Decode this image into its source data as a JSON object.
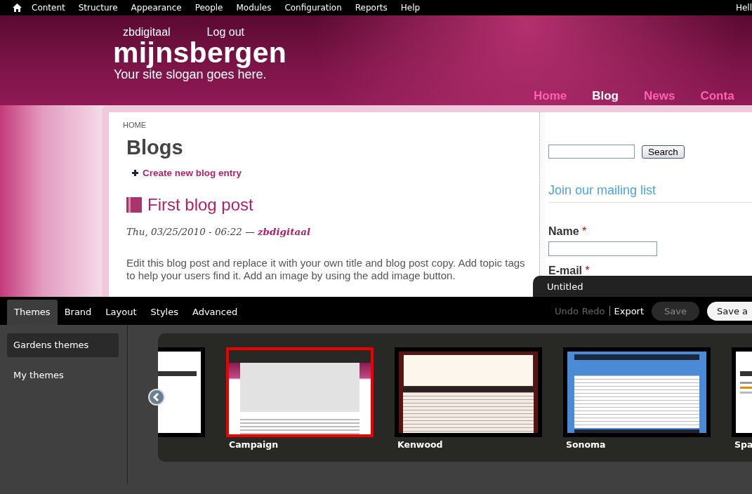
{
  "admin_bar": {
    "menu": [
      "Content",
      "Structure",
      "Appearance",
      "People",
      "Modules",
      "Configuration",
      "Reports",
      "Help"
    ],
    "greeting": "Hell"
  },
  "header": {
    "user_links": [
      "zbdigitaal",
      "Log out"
    ],
    "site_name": "mijnsbergen",
    "slogan": "Your site slogan goes here.",
    "nav": [
      {
        "label": "Home",
        "selected": false
      },
      {
        "label": "Blog",
        "selected": true
      },
      {
        "label": "News",
        "selected": false
      },
      {
        "label": "Conta",
        "selected": false
      }
    ]
  },
  "content": {
    "breadcrumb": "HOME",
    "title": "Blogs",
    "create_link": "Create new blog entry",
    "post": {
      "title": "First blog post",
      "date": "Thu, 03/25/2010 - 06:22 —",
      "author": "zbdigitaal",
      "body": "Edit this blog post and replace it with your own title and blog post copy. Add topic tags to help your users find it. Add an image by using the add image button."
    }
  },
  "sidebar": {
    "search_button": "Search",
    "mailing_title": "Join our mailing list",
    "fields": [
      {
        "label": "Name",
        "required_mark": "*"
      },
      {
        "label": "E-mail",
        "required_mark": "*"
      }
    ]
  },
  "editor": {
    "document_tab": "Untitled",
    "tabs": [
      {
        "label": "Themes",
        "selected": true
      },
      {
        "label": "Brand",
        "selected": false
      },
      {
        "label": "Layout",
        "selected": false
      },
      {
        "label": "Styles",
        "selected": false
      },
      {
        "label": "Advanced",
        "selected": false
      }
    ],
    "history": [
      {
        "label": "Undo",
        "disabled": true
      },
      {
        "label": "Redo",
        "disabled": true
      }
    ],
    "export": "Export",
    "buttons": [
      {
        "label": "Save",
        "disabled": true
      },
      {
        "label": "Save a",
        "disabled": false
      }
    ],
    "categories": [
      {
        "label": "Gardens themes",
        "selected": true
      },
      {
        "label": "My themes",
        "selected": false
      }
    ],
    "themes": [
      {
        "kind": "minimal",
        "selected": false
      },
      {
        "kind": "halftone",
        "label": "Campaign",
        "selected": true
      },
      {
        "kind": "classic",
        "label": "Kenwood",
        "selected": false
      },
      {
        "kind": "cloud",
        "label": "Sonoma",
        "selected": false
      },
      {
        "kind": "minimal",
        "label": "Spa",
        "selected": false
      }
    ]
  }
}
